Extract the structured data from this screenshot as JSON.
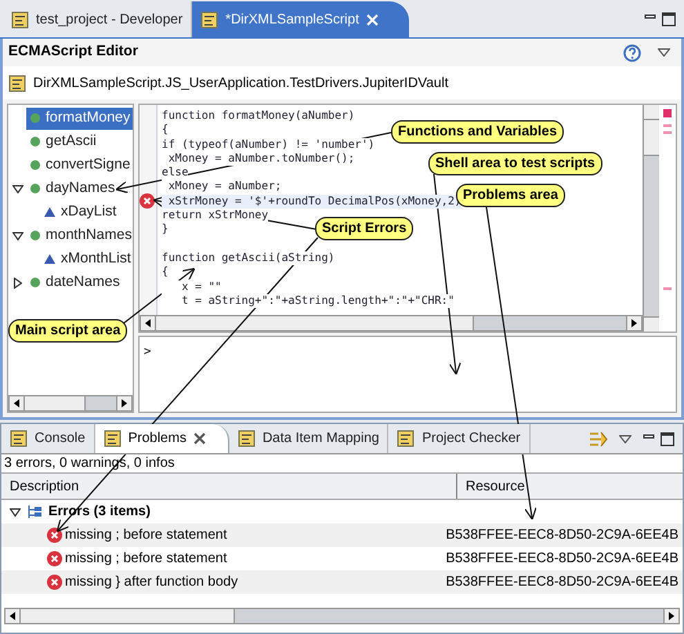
{
  "window_tabs": [
    {
      "label": "test_project - Developer",
      "selected": false,
      "closable": false
    },
    {
      "label": "*DirXMLSampleScript",
      "selected": true,
      "closable": true
    }
  ],
  "editor": {
    "title": "ECMAScript Editor",
    "path": "DirXMLSampleScript.JS_UserApplication.TestDrivers.JupiterIDVault"
  },
  "outline": [
    {
      "label": "formatMoney",
      "kind": "function",
      "selected": true
    },
    {
      "label": "getAscii",
      "kind": "function",
      "selected": false
    },
    {
      "label": "convertSigne",
      "kind": "function",
      "selected": false
    },
    {
      "label": "dayNames",
      "kind": "function",
      "selected": false,
      "expanded": true,
      "children": [
        {
          "label": "xDayList",
          "kind": "variable",
          "selected": false
        }
      ]
    },
    {
      "label": "monthNames",
      "kind": "function",
      "selected": false,
      "expanded": true,
      "children": [
        {
          "label": "xMonthList",
          "kind": "variable",
          "selected": false
        }
      ]
    },
    {
      "label": "dateNames",
      "kind": "function",
      "selected": false,
      "expanded": false
    }
  ],
  "code_lines": [
    {
      "kind": "code",
      "text": "function formatMoney(aNumber)",
      "error": false
    },
    {
      "kind": "code",
      "text": "{",
      "error": false
    },
    {
      "kind": "code",
      "text": "if (typeof(aNumber) != 'number')",
      "error": false
    },
    {
      "kind": "code",
      "text": " xMoney = aNumber.toNumber();",
      "error": false
    },
    {
      "kind": "code",
      "text": "else",
      "error": false
    },
    {
      "kind": "code",
      "text": " xMoney = aNumber;",
      "error": false
    },
    {
      "kind": "code",
      "text": " xStrMoney = '$'+roundTo DecimalPos(xMoney,2)",
      "error": true
    },
    {
      "kind": "code",
      "text": "return xStrMoney",
      "error": false
    },
    {
      "kind": "code",
      "text": "}",
      "error": false
    },
    {
      "kind": "blank",
      "error": false
    },
    {
      "kind": "code",
      "text": "function getAscii(aString)",
      "error": false
    },
    {
      "kind": "code",
      "text": "{",
      "error": false
    },
    {
      "kind": "code",
      "text": "   x = \"\"",
      "error": false
    },
    {
      "kind": "code",
      "text": "   t = aString+\":\"+aString.length+\":\"+\"CHR:\"",
      "error": false
    }
  ],
  "shell": {
    "prompt": ">"
  },
  "bottom_tabs": [
    {
      "label": "Console",
      "selected": false,
      "closable": false
    },
    {
      "label": "Problems",
      "selected": true,
      "closable": true
    },
    {
      "label": "Data Item Mapping",
      "selected": false,
      "closable": false
    },
    {
      "label": "Project Checker",
      "selected": false,
      "closable": false
    }
  ],
  "problems": {
    "summary": "3 errors, 0 warnings, 0 infos",
    "columns": [
      "Description",
      "Resource"
    ],
    "group": {
      "label": "Errors (3 items)",
      "expanded": true
    },
    "rows": [
      {
        "description": "missing ; before statement",
        "resource": "B538FFEE-EEC8-8D50-2C9A-6EE4B"
      },
      {
        "description": "missing ; before statement",
        "resource": "B538FFEE-EEC8-8D50-2C9A-6EE4B"
      },
      {
        "description": "missing } after function body",
        "resource": "B538FFEE-EEC8-8D50-2C9A-6EE4B"
      }
    ]
  },
  "callouts": [
    "Functions and Variables",
    "Shell area to test scripts",
    "Problems area",
    "Script Errors",
    "Main script area"
  ]
}
